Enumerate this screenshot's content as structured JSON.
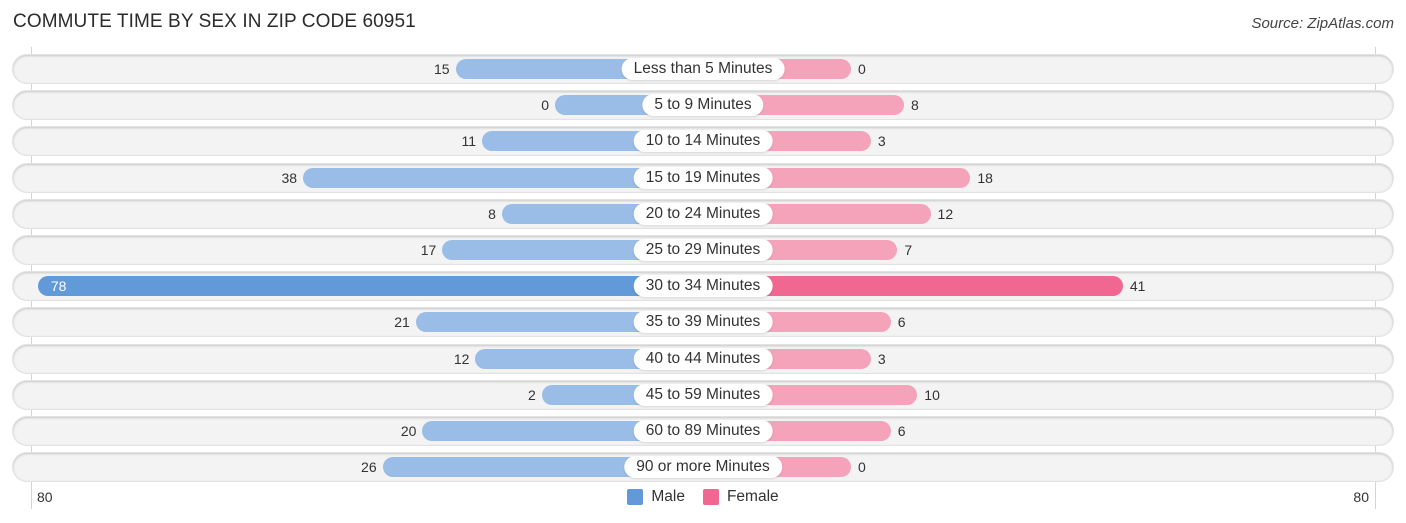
{
  "header": {
    "title": "COMMUTE TIME BY SEX IN ZIP CODE 60951",
    "source": "Source: ZipAtlas.com"
  },
  "colors": {
    "male": "#99bde6",
    "male_strong": "#6199d9",
    "female": "#f5a2bb",
    "female_strong": "#f06892"
  },
  "chart_data": {
    "type": "bar",
    "orientation": "horizontal-diverging",
    "title": "COMMUTE TIME BY SEX IN ZIP CODE 60951",
    "categories": [
      "Less than 5 Minutes",
      "5 to 9 Minutes",
      "10 to 14 Minutes",
      "15 to 19 Minutes",
      "20 to 24 Minutes",
      "25 to 29 Minutes",
      "30 to 34 Minutes",
      "35 to 39 Minutes",
      "40 to 44 Minutes",
      "45 to 59 Minutes",
      "60 to 89 Minutes",
      "90 or more Minutes"
    ],
    "series": [
      {
        "name": "Male",
        "side": "left",
        "values": [
          15,
          0,
          11,
          38,
          8,
          17,
          78,
          21,
          12,
          2,
          20,
          26
        ]
      },
      {
        "name": "Female",
        "side": "right",
        "values": [
          0,
          8,
          3,
          18,
          12,
          7,
          41,
          6,
          3,
          10,
          6,
          0
        ]
      }
    ],
    "axis": {
      "left_label": "80",
      "right_label": "80",
      "max": 80
    },
    "legend": {
      "position": "bottom-center",
      "entries": [
        "Male",
        "Female"
      ]
    },
    "grid": false
  }
}
